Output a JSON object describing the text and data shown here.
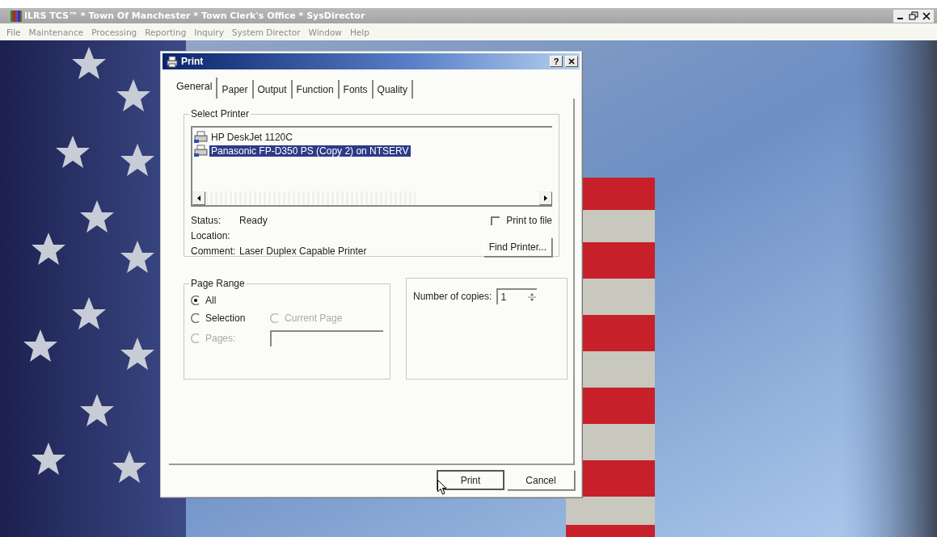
{
  "window": {
    "title": "ILRS TCS™ * Town Of Manchester * Town Clerk's Office * SysDirector"
  },
  "menu": [
    "File",
    "Maintenance",
    "Processing",
    "Reporting",
    "Inquiry",
    "System Director",
    "Window",
    "Help"
  ],
  "dialog": {
    "title": "Print",
    "help_button": "?",
    "tabs": [
      {
        "label": "General",
        "selected": true
      },
      {
        "label": "Paper",
        "selected": false
      },
      {
        "label": "Output",
        "selected": false
      },
      {
        "label": "Function",
        "selected": false
      },
      {
        "label": "Fonts",
        "selected": false
      },
      {
        "label": "Quality",
        "selected": false
      }
    ],
    "select_printer": {
      "label": "Select Printer",
      "printers": [
        {
          "name": "HP DeskJet 1120C",
          "selected": false
        },
        {
          "name": "Panasonic FP-D350 PS (Copy 2) on NTSERV",
          "selected": true
        }
      ],
      "status_label": "Status:",
      "status": "Ready",
      "location_label": "Location:",
      "comment_label": "Comment:",
      "comment": "Laser Duplex Capable Printer",
      "print_to_file": {
        "label": "Print to file",
        "checked": false
      },
      "find_button": "Find Printer..."
    },
    "page_range": {
      "label": "Page Range",
      "options": [
        {
          "label": "All",
          "selected": true,
          "disabled": false
        },
        {
          "label": "Selection",
          "selected": false,
          "disabled": false
        },
        {
          "label": "Current Page",
          "selected": false,
          "disabled": true
        },
        {
          "label": "Pages:",
          "selected": false,
          "disabled": true
        }
      ]
    },
    "copies": {
      "label": "Number of copies:",
      "value": "1"
    },
    "buttons": [
      {
        "label": "Print",
        "default": true
      },
      {
        "label": "Cancel",
        "default": false
      }
    ]
  }
}
